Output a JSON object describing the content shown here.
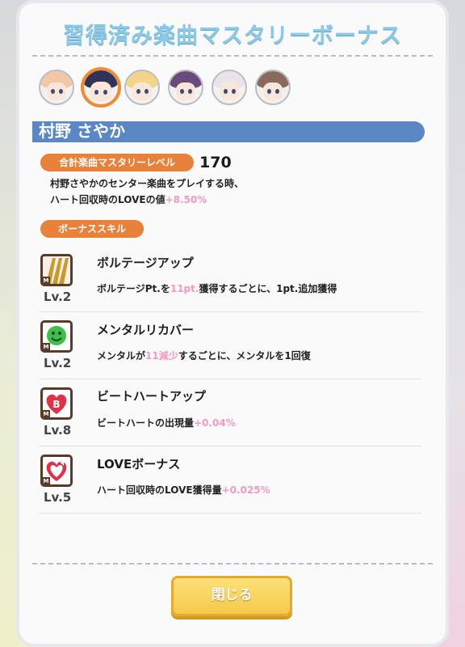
{
  "title": "習得済み楽曲マスタリーボーナス",
  "character_name": "村野 さやか",
  "avatars": [
    {
      "name": "avatar-1",
      "hair": "#f2c7a5",
      "selected": false
    },
    {
      "name": "avatar-2",
      "hair": "#2f3357",
      "selected": true
    },
    {
      "name": "avatar-3",
      "hair": "#f3d58a",
      "selected": false
    },
    {
      "name": "avatar-4",
      "hair": "#6a4a7a",
      "selected": false
    },
    {
      "name": "avatar-5",
      "hair": "#e9e4ea",
      "selected": false
    },
    {
      "name": "avatar-6",
      "hair": "#8a6a5c",
      "selected": false
    }
  ],
  "mastery": {
    "label": "合計楽曲マスタリーレベル",
    "level": "170",
    "desc_line1": "村野さやかのセンター楽曲をプレイする時、",
    "desc_line2": "ハート回収時のLOVEの値",
    "desc_value": "+8.50%"
  },
  "bonus_skill_label": "ボーナススキル",
  "skills": [
    {
      "name": "ボルテージアップ",
      "level": "Lv.2",
      "icon": "voltage-up-icon",
      "icon_mark": "M",
      "desc_pre": "ボルテージPt.を",
      "desc_value": "11pt.",
      "desc_post": "獲得するごとに、1pt.追加獲得"
    },
    {
      "name": "メンタルリカバー",
      "level": "Lv.2",
      "icon": "mental-recover-icon",
      "icon_mark": "M",
      "desc_pre": "メンタルが",
      "desc_value": "11減少",
      "desc_post": "するごとに、メンタルを1回復"
    },
    {
      "name": "ビートハートアップ",
      "level": "Lv.8",
      "icon": "beat-heart-up-icon",
      "icon_mark": "M",
      "icon_letter": "B",
      "desc_pre": "ビートハートの出現量",
      "desc_value": "+0.04%",
      "desc_post": ""
    },
    {
      "name": "LOVEボーナス",
      "level": "Lv.5",
      "icon": "love-bonus-icon",
      "icon_mark": "M",
      "desc_pre": "ハート回収時のLOVE獲得量",
      "desc_value": "+0.025%",
      "desc_post": ""
    }
  ],
  "close_button": "閉じる"
}
